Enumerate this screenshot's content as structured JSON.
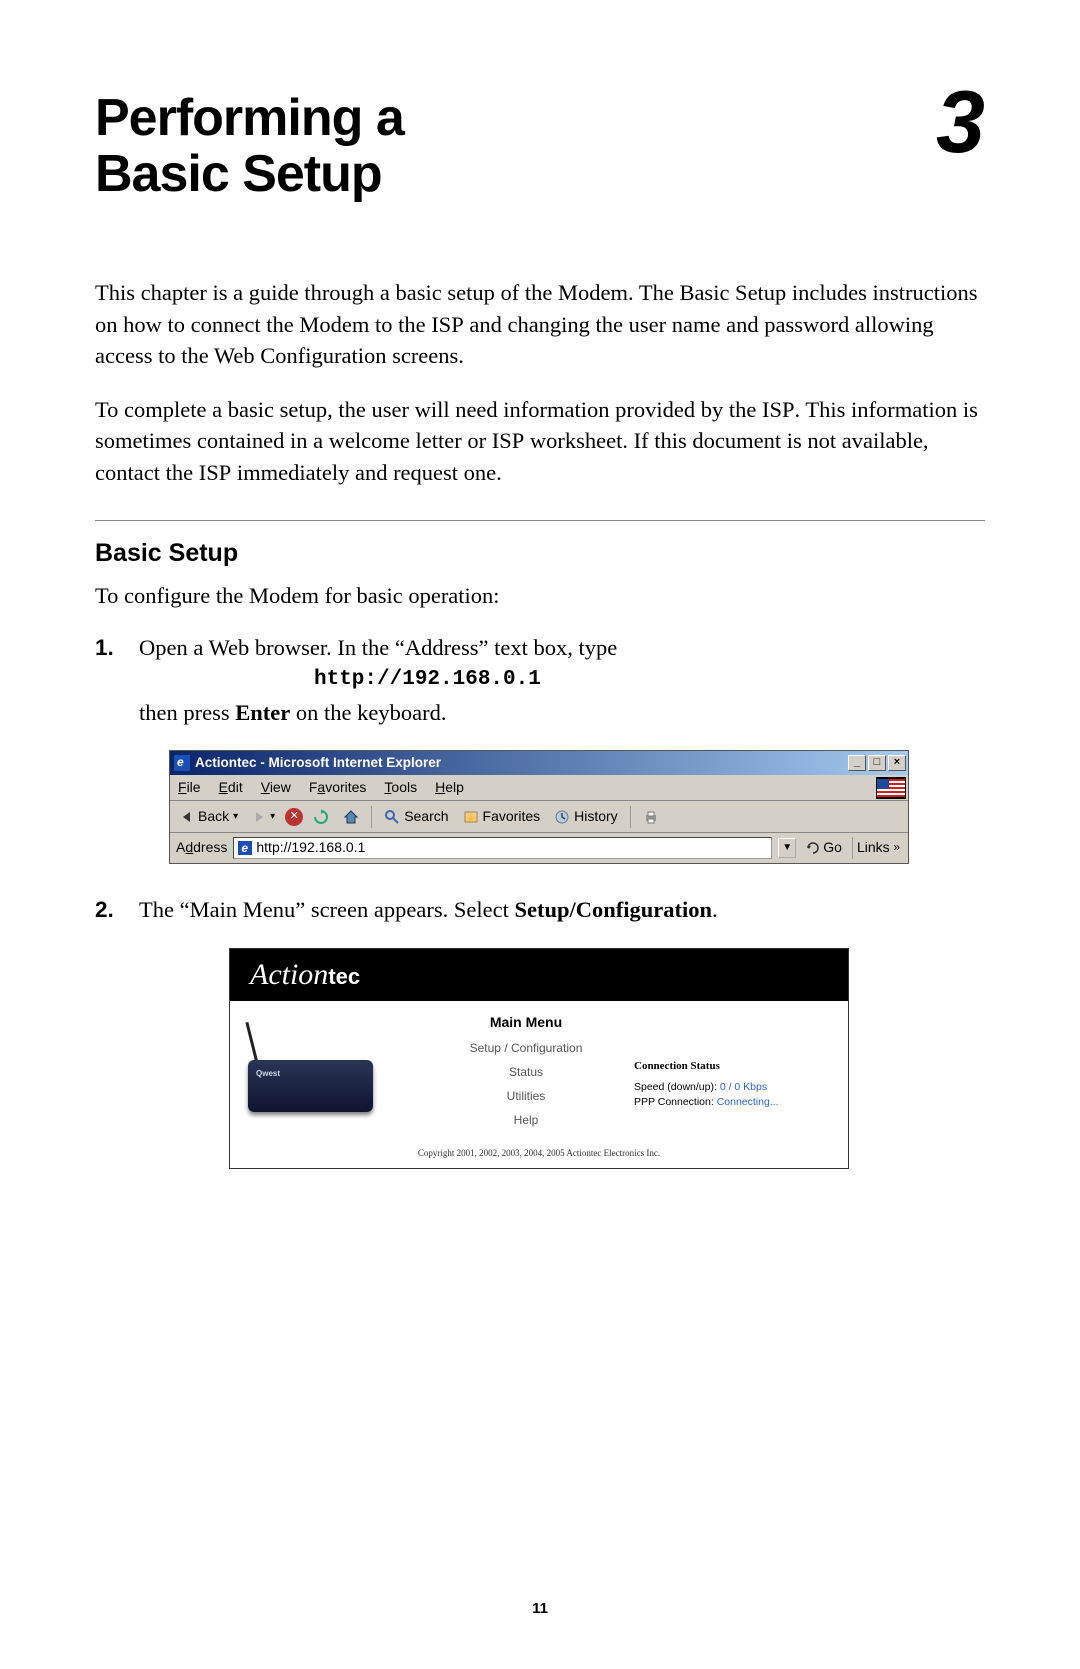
{
  "chapter": {
    "title_line1": "Performing a",
    "title_line2": "Basic Setup",
    "number": "3"
  },
  "paragraphs": {
    "p1_a": "This chapter is a guide through a basic setup of the Modem. The Basic Setup includes instructions on how to connect the Modem to the ",
    "p1_b": " and changing the user name and password allowing access to the Web Configuration screens.",
    "p2_a": "To complete a basic setup, the user will need information provided by the ",
    "p2_b": ". This information is sometimes contained in a welcome letter or ",
    "p2_c": " worksheet. If this document is not available, contact the ",
    "p2_d": " immediately and request one.",
    "isp": "ISP"
  },
  "section": {
    "heading": "Basic Setup",
    "intro": "To configure the Modem for basic operation:"
  },
  "steps": {
    "s1_a": "Open a Web browser. In the “Address” text box, type",
    "s1_url": "http://192.168.0.1",
    "s1_b": "then press ",
    "s1_bold": "Enter",
    "s1_c": " on the keyboard.",
    "s2_a": "The “Main Menu” screen appears. Select ",
    "s2_bold": "Setup/Configuration",
    "s2_c": "."
  },
  "ie": {
    "title": "Actiontec - Microsoft Internet Explorer",
    "menu": {
      "file": "File",
      "file_u": "F",
      "edit": "Edit",
      "edit_u": "E",
      "view": "View",
      "view_u": "V",
      "favorites": "Favorites",
      "favorites_u": "a",
      "tools": "Tools",
      "tools_u": "T",
      "help": "Help",
      "help_u": "H"
    },
    "toolbar": {
      "back": "Back",
      "search": "Search",
      "favorites": "Favorites",
      "history": "History"
    },
    "address_label": "Address",
    "address_value": "http://192.168.0.1",
    "go": "Go",
    "links": "Links"
  },
  "actiontec": {
    "logo_script": "Action",
    "logo_tec": "tec",
    "menu_title": "Main Menu",
    "menu_items": [
      "Setup / Configuration",
      "Status",
      "Utilities",
      "Help"
    ],
    "status_heading": "Connection Status",
    "speed_label": "Speed (down/up): ",
    "speed_value": "0 / 0 Kbps",
    "ppp_label": "PPP Connection:   ",
    "ppp_value": "Connecting...",
    "modem_brand": "Qwest",
    "copyright": "Copyright 2001, 2002, 2003, 2004, 2005 Actiontec Electronics Inc."
  },
  "page_number": "11"
}
